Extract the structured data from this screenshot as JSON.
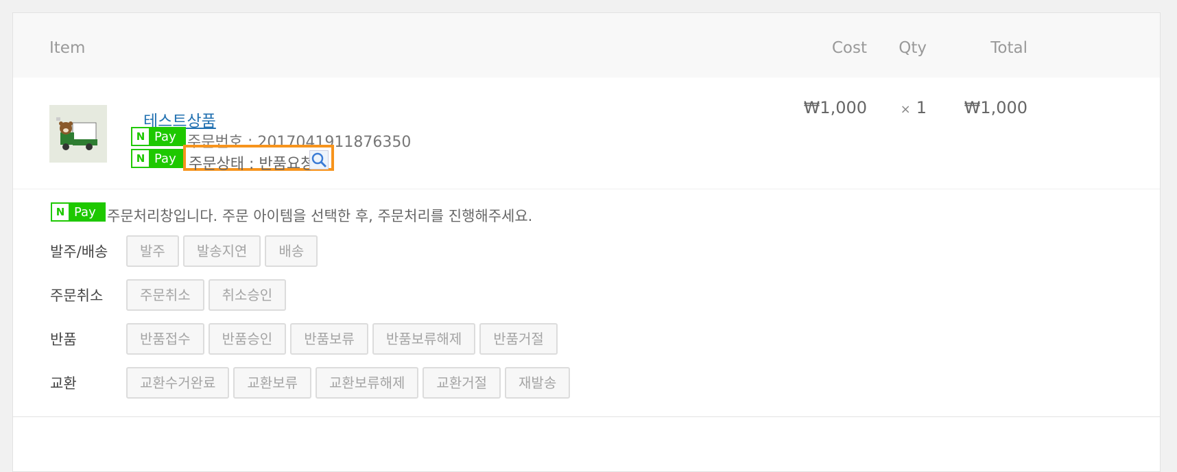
{
  "table_header": {
    "item": "Item",
    "cost": "Cost",
    "qty": "Qty",
    "total": "Total"
  },
  "order_item": {
    "product_name": "테스트상품",
    "cost": "₩1,000",
    "qty_symbol": "×",
    "qty": "1",
    "total": "₩1,000",
    "order_number_line": "주문번호 : 2017041911876350",
    "order_status_line": "주문상태 : 반품요청",
    "status_icon": "magnifier-icon"
  },
  "npay_badge": {
    "n": "N",
    "pay": "Pay"
  },
  "processing": {
    "notice": "주문처리창입니다. 주문 아이템을 선택한 후, 주문처리를 진행해주세요.",
    "groups": [
      {
        "label": "발주/배송",
        "buttons": [
          "발주",
          "발송지연",
          "배송"
        ]
      },
      {
        "label": "주문취소",
        "buttons": [
          "주문취소",
          "취소승인"
        ]
      },
      {
        "label": "반품",
        "buttons": [
          "반품접수",
          "반품승인",
          "반품보류",
          "반품보류해제",
          "반품거절"
        ]
      },
      {
        "label": "교환",
        "buttons": [
          "교환수거완료",
          "교환보류",
          "교환보류해제",
          "교환거절",
          "재발송"
        ]
      }
    ]
  },
  "colors": {
    "npay_green": "#1ec800",
    "highlight_orange": "#f7941d",
    "link_blue": "#2271b1"
  }
}
